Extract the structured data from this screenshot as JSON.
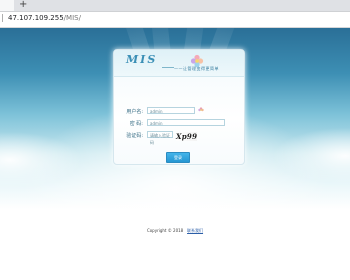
{
  "browser": {
    "new_tab_label": "+",
    "address_host": "47.107.109.255",
    "address_path": "/MIS/"
  },
  "login": {
    "brand": "MIS",
    "tagline": "——让管理变得更简单",
    "username_label": "用户名:",
    "username_value": "admin",
    "password_label": "密 码:",
    "password_value": "admin",
    "captcha_label": "验证码:",
    "captcha_value": "请输入验证码",
    "captcha_text": "Xp99",
    "submit_label": "登录"
  },
  "footer": {
    "copyright": "Copyright © 2018",
    "link": "联系我们"
  },
  "colors": {
    "accent": "#2596d2",
    "brand": "#3a8fb6"
  }
}
